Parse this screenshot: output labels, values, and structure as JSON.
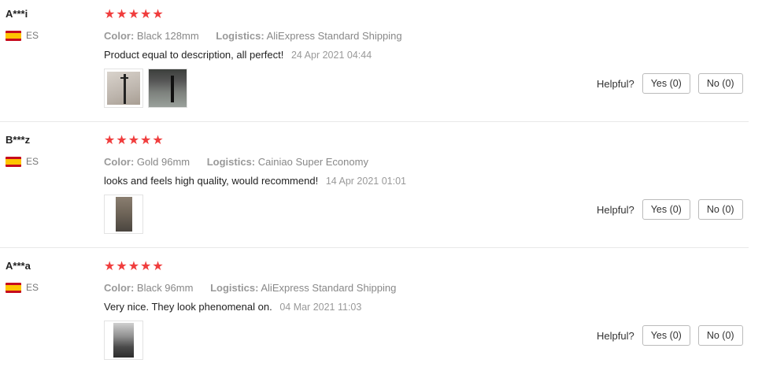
{
  "reviews": [
    {
      "user": "A***i",
      "country": "ES",
      "stars": "★★★★★",
      "color_label": "Color:",
      "color_value": "Black 128mm",
      "logistics_label": "Logistics:",
      "logistics_value": "AliExpress Standard Shipping",
      "text": "Product equal to description, all perfect!",
      "date": "24 Apr 2021 04:44",
      "photo_count": 2,
      "helpful_label": "Helpful?",
      "yes_label": "Yes (0)",
      "no_label": "No (0)"
    },
    {
      "user": "B***z",
      "country": "ES",
      "stars": "★★★★★",
      "color_label": "Color:",
      "color_value": "Gold 96mm",
      "logistics_label": "Logistics:",
      "logistics_value": "Cainiao Super Economy",
      "text": "looks and feels high quality, would recommend!",
      "date": "14 Apr 2021 01:01",
      "photo_count": 1,
      "helpful_label": "Helpful?",
      "yes_label": "Yes (0)",
      "no_label": "No (0)"
    },
    {
      "user": "A***a",
      "country": "ES",
      "stars": "★★★★★",
      "color_label": "Color:",
      "color_value": "Black 96mm",
      "logistics_label": "Logistics:",
      "logistics_value": "AliExpress Standard Shipping",
      "text": "Very nice. They look phenomenal on.",
      "date": "04 Mar 2021 11:03",
      "photo_count": 1,
      "helpful_label": "Helpful?",
      "yes_label": "Yes (0)",
      "no_label": "No (0)"
    }
  ],
  "colors": {
    "star": "#f03d3d",
    "divider": "#e8e8e8"
  }
}
